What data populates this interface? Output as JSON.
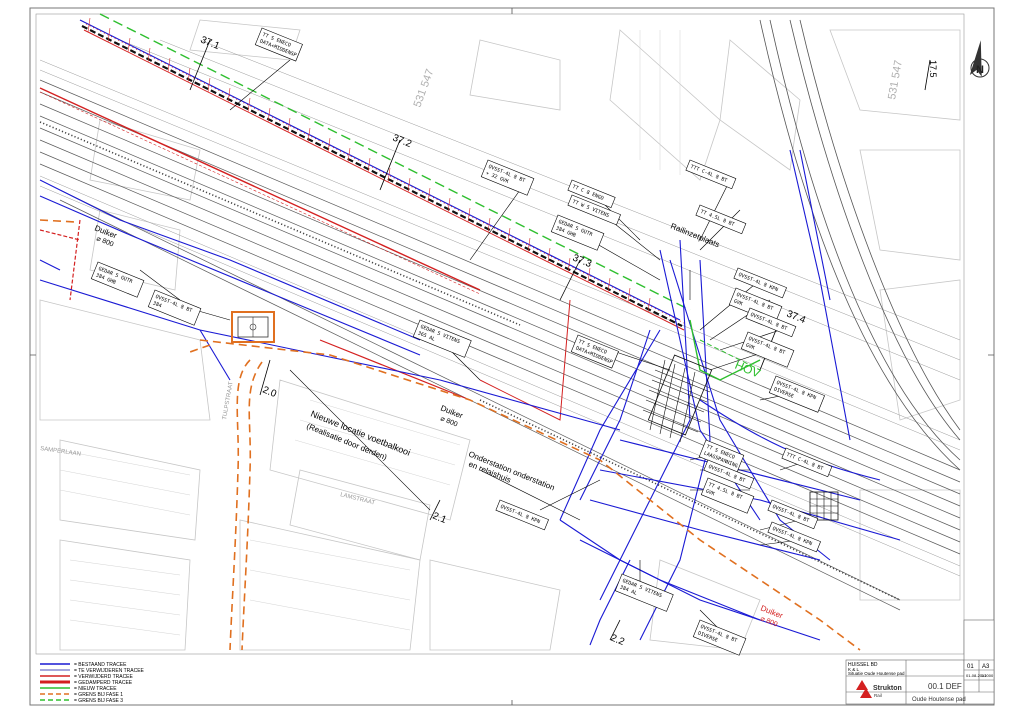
{
  "drawing": {
    "km_markers": [
      "37.1",
      "37.2",
      "37.3",
      "37.4",
      "2.0",
      "2.1",
      "2.2",
      "17.5"
    ],
    "grid_labels": [
      "531 547",
      "531 547"
    ],
    "callouts": [
      "TT  S  ENECO\nDATA+MIDDENSP",
      "OVSST-4L  8  BT\n+ 32  GVK",
      "TT C   8  ENGD",
      "TT W   5  VITENS",
      "GEDAR   5  GUTR\n384         GHB",
      "TTT C-4L  8  BT",
      "TT 4.5L   8  BT",
      "GEDAR   5  GUTR\n384         GHB",
      "OVSST-4L  8  BT\n384",
      "GEDAR   5  VITENS\n365         AL",
      "TT  S  ENECO\nDATA+MIDDENSP",
      "OVSST-4L  8  KPN",
      "OVSST-4L  8  BT\nGVK",
      "OVSST-4L  8  BT",
      "OVSST-4L  8  BT\nGVK",
      "OVSST-4L  8  KPN\nDIVERSE",
      "TTT C-4L  8  BT",
      "TT  S  ENECO\nLAAGSPANNING",
      "OVSST-4L  8  BT",
      "TT 4.5L   8  BT\nGVK",
      "OVSST-4L  8  KPN",
      "OVSST-4L  8  BT",
      "OVSST-4L  8  KPN",
      "GEDAR   5  VITENS\n384         AL",
      "OVSST-4L  8  BT\nDIVERSE"
    ],
    "labels": {
      "duiker1": "Duiker",
      "duiker1_size": "⌀ 800",
      "duiker2": "Duiker",
      "duiker2_size": "⌀ 800",
      "duiker3": "Duiker",
      "duiker3_size": "⌀ 800",
      "voetbalkooi": "Nieuwe locatie voetbalkooi",
      "voetbalkooi_sub": "(Realisatie door derden)",
      "onderstation": "Onderstation onderstation",
      "relaishuis": "en relaishuis",
      "railinzetplaats": "Railinzetplaats",
      "hov": "HOV",
      "street1": "SAMPERLAAN",
      "street2": "LAMSTRAAT",
      "street3": "TULPSTRAAT"
    }
  },
  "legend": {
    "items": [
      {
        "label": "= BESTAAND TRACEE",
        "color": "#1a1ad4",
        "style": "solid"
      },
      {
        "label": "= TE VERWIJDEREN TRACEE",
        "color": "#8a8ad0",
        "style": "solid"
      },
      {
        "label": "= VERWIJDERD TRACEE",
        "color": "#d42020",
        "style": "solid"
      },
      {
        "label": "= GEDAMPERD TRACEE",
        "color": "#d42020",
        "style": "thick"
      },
      {
        "label": "= NIEUW TRACEE",
        "color": "#2fbf2f",
        "style": "solid"
      },
      {
        "label": "= GRENS BIJ FASE 1",
        "color": "#e07020",
        "style": "dashed"
      },
      {
        "label": "= GRENS BIJ FASE 3",
        "color": "#2fbf2f",
        "style": "dashed"
      }
    ]
  },
  "title_block": {
    "project": "HUISSEL BD",
    "sub1": "K & L",
    "sub2": "Situatie Oude Houtense pad",
    "company": "Strukton",
    "company_sub": "Rail",
    "drawing_no": "00.1 DEF",
    "drawing_name": "Oude Houtense pad",
    "sheet": "01",
    "format": "A3",
    "scale": "1:1000",
    "date": "01-08-2012"
  },
  "colors": {
    "existing": "#1a1ad4",
    "removed": "#d42020",
    "new": "#2fbf2f",
    "fase1": "#e07020",
    "base": "#b8b8b8",
    "track": "#4a4a4a"
  }
}
